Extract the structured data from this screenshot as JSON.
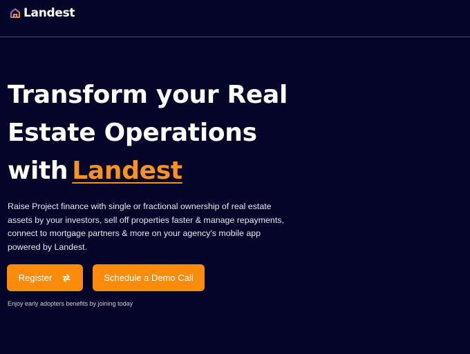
{
  "brand": {
    "name": "Landest",
    "accent_color": "#f7931e",
    "logo_icon": "house-icon"
  },
  "hero": {
    "title_line1": "Transform your Real",
    "title_line2": "Estate Operations",
    "title_line3_prefix": "with",
    "title_highlight": "Landest",
    "description": "Raise Project finance with single or fractional ownership of real estate assets by your investors, sell off properties faster & manage repayments, connect to mortgage partners & more on your agency's mobile app powered by Landest."
  },
  "actions": {
    "register_label": "Register",
    "register_icon": "swap-arrows-icon",
    "demo_label": "Schedule a Demo Call",
    "button_color": "#fa8c0a"
  },
  "footnote": "Enjoy early adopters benefits by joining today",
  "colors": {
    "background": "#05052a",
    "divider": "#4a4a6a"
  }
}
